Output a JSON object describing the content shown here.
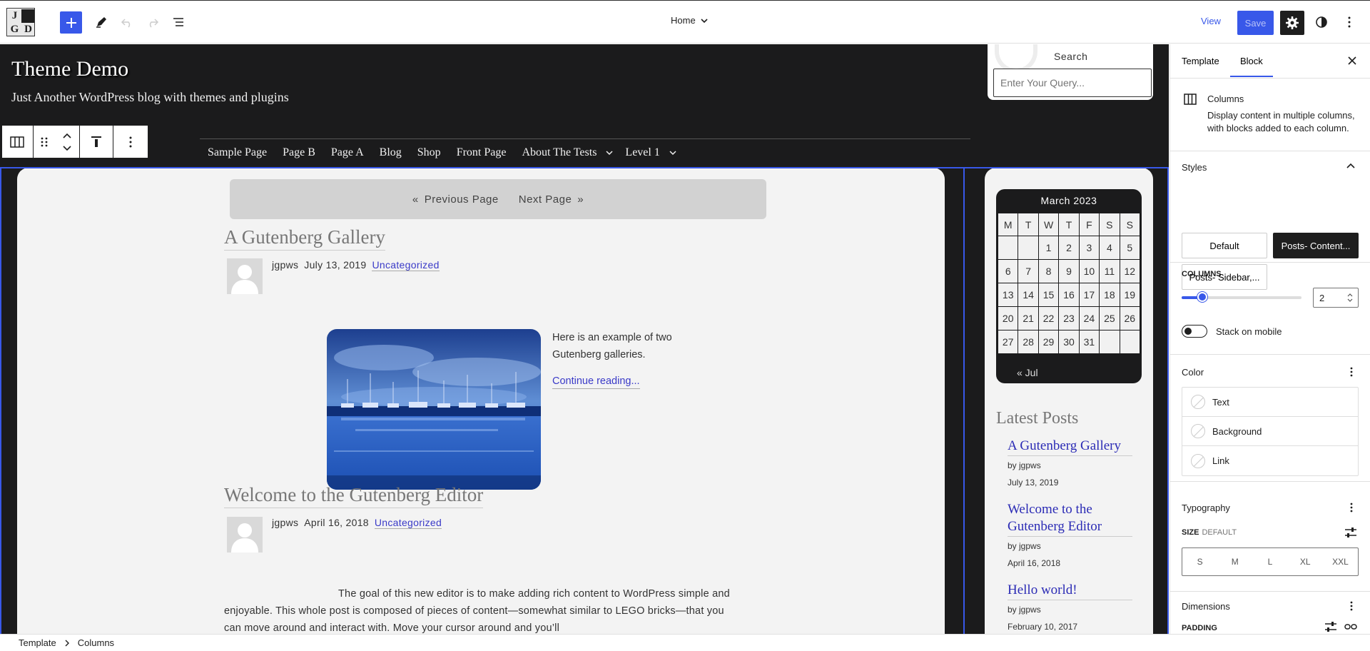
{
  "topbar": {
    "logo_letters": [
      "J",
      "",
      "G",
      "D"
    ],
    "template_selector": "Home",
    "view_label": "View",
    "save_label": "Save"
  },
  "canvas": {
    "site_title": "Theme Demo",
    "tagline": "Just Another WordPress blog with themes and plugins",
    "search": {
      "label": "Search",
      "placeholder": "Enter Your Query..."
    },
    "nav": [
      "Sample Page",
      "Page B",
      "Page A",
      "Blog",
      "Shop",
      "Front Page",
      "About The Tests",
      "Level 1"
    ],
    "pager": {
      "prev": "Previous Page",
      "next": "Next Page"
    },
    "posts": [
      {
        "title": "A Gutenberg Gallery",
        "author": "jgpws",
        "date": "July 13, 2019",
        "category": "Uncategorized",
        "excerpt": "Here is an example of two Gutenberg galleries.",
        "read_more": "Continue reading..."
      },
      {
        "title": "Welcome to the Gutenberg Editor",
        "author": "jgpws",
        "date": "April 16, 2018",
        "category": "Uncategorized",
        "excerpt": "The goal of this new editor is to make adding rich content to WordPress simple and enjoyable. This whole post is composed of pieces of content—somewhat similar to LEGO bricks—that you can move around and interact with. Move your cursor around and you’ll"
      }
    ],
    "calendar": {
      "caption": "March 2023",
      "headers": [
        "M",
        "T",
        "W",
        "T",
        "F",
        "S",
        "S"
      ],
      "days": [
        "",
        "",
        "1",
        "2",
        "3",
        "4",
        "5",
        "6",
        "7",
        "8",
        "9",
        "10",
        "11",
        "12",
        "13",
        "14",
        "15",
        "16",
        "17",
        "18",
        "19",
        "20",
        "21",
        "22",
        "23",
        "24",
        "25",
        "26",
        "27",
        "28",
        "29",
        "30",
        "31",
        "",
        ""
      ],
      "prev": "« Jul"
    },
    "latest_posts": {
      "title": "Latest Posts",
      "items": [
        {
          "title": "A Gutenberg Gallery",
          "by": "by jgpws",
          "date": "July 13, 2019"
        },
        {
          "title": "Welcome to the Gutenberg Editor",
          "by": "by jgpws",
          "date": "April 16, 2018"
        },
        {
          "title": "Hello world!",
          "by": "by jgpws",
          "date": "February 10, 2017"
        }
      ]
    }
  },
  "sidebar": {
    "tabs": [
      "Template",
      "Block"
    ],
    "block": {
      "name": "Columns",
      "description": "Display content in multiple columns, with blocks added to each column."
    },
    "styles": {
      "title": "Styles",
      "options": [
        "Default",
        "Posts- Content...",
        "Posts- Sidebar,..."
      ],
      "selected": 1
    },
    "columns": {
      "label": "Columns",
      "value": "2",
      "slider_fraction": 0.17
    },
    "stack_label": "Stack on mobile",
    "color": {
      "title": "Color",
      "items": [
        "Text",
        "Background",
        "Link"
      ]
    },
    "typography": {
      "title": "Typography",
      "size_label": "Size",
      "size_value": "Default",
      "sizes": [
        "S",
        "M",
        "L",
        "XL",
        "XXL"
      ]
    },
    "dimensions": {
      "title": "Dimensions",
      "padding_label": "Padding"
    }
  },
  "breadcrumb": [
    "Template",
    "Columns"
  ]
}
